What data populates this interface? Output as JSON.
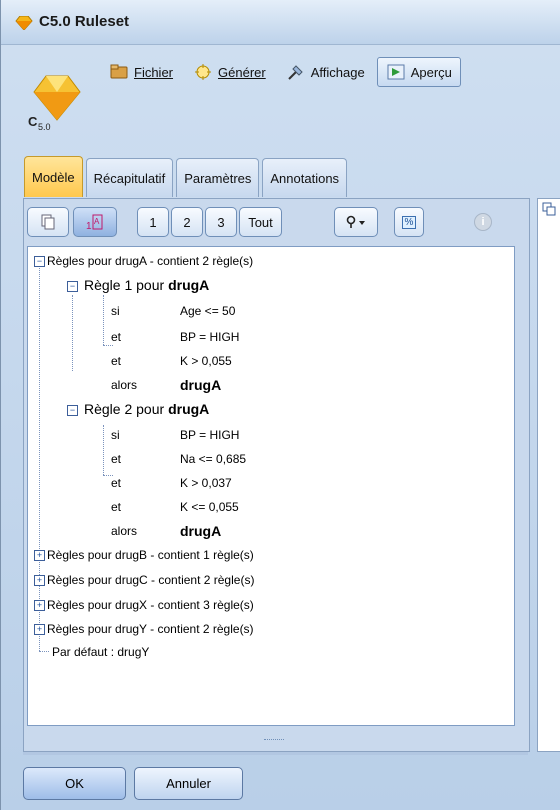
{
  "window": {
    "title": "C5.0 Ruleset"
  },
  "menu": [
    {
      "label": "Fichier",
      "icon": "folder-icon",
      "mnemonic": "F"
    },
    {
      "label": "Générer",
      "icon": "generate-icon",
      "mnemonic": "G"
    },
    {
      "label": "Affichage",
      "icon": "view-icon",
      "mnemonic": ""
    },
    {
      "label": "Aperçu",
      "icon": "preview-icon",
      "mnemonic": ""
    }
  ],
  "logo_text": "C5.0",
  "tabs": [
    "Modèle",
    "Récapitulatif",
    "Paramètres",
    "Annotations"
  ],
  "toolbar": {
    "level1": "1",
    "level2": "2",
    "level3": "3",
    "all": "Tout",
    "percent": "%"
  },
  "tree": {
    "groupA": "Règles pour drugA - contient 2 règle(s)",
    "rule1": {
      "head": "Règle 1 pour ",
      "target": "drugA",
      "conds": [
        {
          "kw": "si",
          "cond": "Age <= 50"
        },
        {
          "kw": "et",
          "cond": "BP = HIGH"
        },
        {
          "kw": "et",
          "cond": "K > 0,055"
        }
      ],
      "then_kw": "alors",
      "then_val": "drugA"
    },
    "rule2": {
      "head": "Règle 2 pour ",
      "target": "drugA",
      "conds": [
        {
          "kw": "si",
          "cond": "BP = HIGH"
        },
        {
          "kw": "et",
          "cond": "Na <= 0,685"
        },
        {
          "kw": "et",
          "cond": "K > 0,037"
        },
        {
          "kw": "et",
          "cond": "K <= 0,055"
        }
      ],
      "then_kw": "alors",
      "then_val": "drugA"
    },
    "groups": [
      "Règles pour drugB - contient 1 règle(s)",
      "Règles pour drugC - contient 2 règle(s)",
      "Règles pour drugX - contient 3 règle(s)",
      "Règles pour drugY - contient 2 règle(s)"
    ],
    "default": "Par défaut : drugY"
  },
  "buttons": {
    "ok": "OK",
    "cancel": "Annuler"
  }
}
